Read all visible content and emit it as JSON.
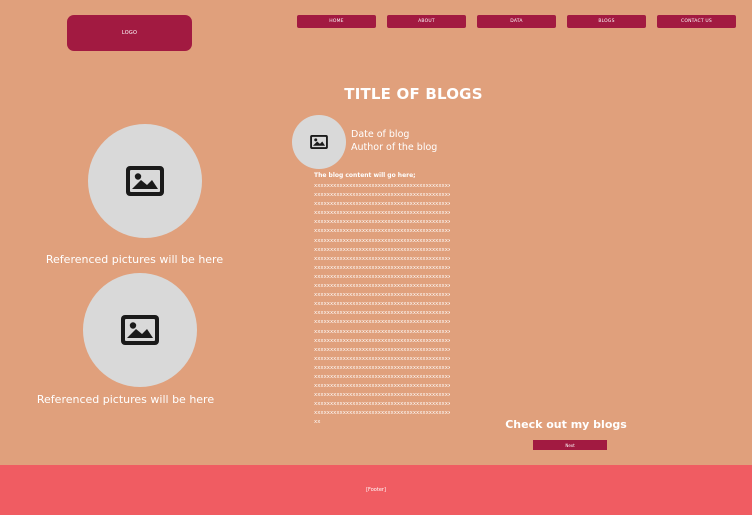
{
  "header": {
    "logo_label": "LOGO",
    "nav": [
      "HOME",
      "ABOUT",
      "DATA",
      "BLOGS",
      "CONTACT US"
    ]
  },
  "page_title": "TITLE OF BLOGS",
  "references": {
    "captions": [
      "Referenced pictures will be here",
      "Referenced pictures will be here"
    ],
    "icon": "image-icon"
  },
  "blog": {
    "author_icon": "image-icon",
    "date": "Date of blog",
    "author": "Author of the blog",
    "content_intro": "The blog content will go here;",
    "content_lines": [
      "xxxxxxxxxxxxxxxxxxxxxxxxxxxxxxxxxxxxxxxxxxxxxxxxxx",
      "xxxxxxxxxxxxxxxxxxxxxxxxxxxxxxxxxxxxxxxxxxxxxxxxxx",
      "xxxxxxxxxxxxxxxxxxxxxxxxxxxxxxxxxxxxxxxxxxxxxxxxxx",
      "xxxxxxxxxxxxxxxxxxxxxxxxxxxxxxxxxxxxxxxxxxxxxxxxxx",
      "xxxxxxxxxxxxxxxxxxxxxxxxxxxxxxxxxxxxxxxxxxxxxxxxxx",
      "xxxxxxxxxxxxxxxxxxxxxxxxxxxxxxxxxxxxxxxxxxxxxxxxxx",
      "xxxxxxxxxxxxxxxxxxxxxxxxxxxxxxxxxxxxxxxxxxxxxxxxxx",
      "xxxxxxxxxxxxxxxxxxxxxxxxxxxxxxxxxxxxxxxxxxxxxxxxxx",
      "xxxxxxxxxxxxxxxxxxxxxxxxxxxxxxxxxxxxxxxxxxxxxxxxxx",
      "xxxxxxxxxxxxxxxxxxxxxxxxxxxxxxxxxxxxxxxxxxxxxxxxxx",
      "xxxxxxxxxxxxxxxxxxxxxxxxxxxxxxxxxxxxxxxxxxxxxxxxxx",
      "xxxxxxxxxxxxxxxxxxxxxxxxxxxxxxxxxxxxxxxxxxxxxxxxxx",
      "xxxxxxxxxxxxxxxxxxxxxxxxxxxxxxxxxxxxxxxxxxxxxxxxxx",
      "xxxxxxxxxxxxxxxxxxxxxxxxxxxxxxxxxxxxxxxxxxxxxxxxxx",
      "xxxxxxxxxxxxxxxxxxxxxxxxxxxxxxxxxxxxxxxxxxxxxxxxxx",
      "xxxxxxxxxxxxxxxxxxxxxxxxxxxxxxxxxxxxxxxxxxxxxxxxxx",
      "xxxxxxxxxxxxxxxxxxxxxxxxxxxxxxxxxxxxxxxxxxxxxxxxxx",
      "xxxxxxxxxxxxxxxxxxxxxxxxxxxxxxxxxxxxxxxxxxxxxxxxxx",
      "xxxxxxxxxxxxxxxxxxxxxxxxxxxxxxxxxxxxxxxxxxxxxxxxxx",
      "xxxxxxxxxxxxxxxxxxxxxxxxxxxxxxxxxxxxxxxxxxxxxxxxxx",
      "xxxxxxxxxxxxxxxxxxxxxxxxxxxxxxxxxxxxxxxxxxxxxxxxxx",
      "xxxxxxxxxxxxxxxxxxxxxxxxxxxxxxxxxxxxxxxxxxxxxxxxxx",
      "xxxxxxxxxxxxxxxxxxxxxxxxxxxxxxxxxxxxxxxxxxxxxxxxxx",
      "xxxxxxxxxxxxxxxxxxxxxxxxxxxxxxxxxxxxxxxxxxxxxxxxxx",
      "xxxxxxxxxxxxxxxxxxxxxxxxxxxxxxxxxxxxxxxxxxxxxxxxxx",
      "xxxxxxxxxxxxxxxxxxxxxxxxxxxxxxxxxxxxxxxxxxxxxxxxxx",
      "xx"
    ]
  },
  "more": {
    "title": "Check out my blogs",
    "next_label": "Next"
  },
  "footer": {
    "label": "[Footer]"
  },
  "colors": {
    "background": "#e0a07c",
    "accent": "#a21a41",
    "footer": "#f05c62",
    "placeholder": "#d9d9d9"
  }
}
